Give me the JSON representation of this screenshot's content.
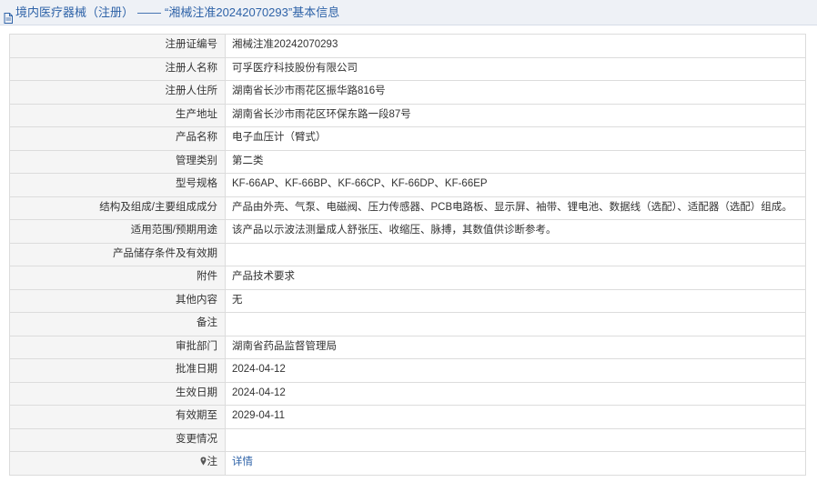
{
  "header": {
    "section": "境内医疗器械（注册）",
    "dash": "——",
    "title": "“湘械注准20242070293”基本信息"
  },
  "rows": [
    {
      "label": "注册证编号",
      "value": "湘械注准20242070293"
    },
    {
      "label": "注册人名称",
      "value": "可孚医疗科技股份有限公司"
    },
    {
      "label": "注册人住所",
      "value": "湖南省长沙市雨花区振华路816号"
    },
    {
      "label": "生产地址",
      "value": "湖南省长沙市雨花区环保东路一段87号"
    },
    {
      "label": "产品名称",
      "value": "电子血压计（臂式）"
    },
    {
      "label": "管理类别",
      "value": "第二类"
    },
    {
      "label": "型号规格",
      "value": "KF-66AP、KF-66BP、KF-66CP、KF-66DP、KF-66EP"
    },
    {
      "label": "结构及组成/主要组成成分",
      "value": "产品由外壳、气泵、电磁阀、压力传感器、PCB电路板、显示屏、袖带、锂电池、数据线（选配）、适配器（选配）组成。"
    },
    {
      "label": "适用范围/预期用途",
      "value": "该产品以示波法测量成人舒张压、收缩压、脉搏，其数值供诊断参考。"
    },
    {
      "label": "产品储存条件及有效期",
      "value": ""
    },
    {
      "label": "附件",
      "value": "产品技术要求"
    },
    {
      "label": "其他内容",
      "value": "无"
    },
    {
      "label": "备注",
      "value": ""
    },
    {
      "label": "审批部门",
      "value": "湖南省药品监督管理局"
    },
    {
      "label": "批准日期",
      "value": "2024-04-12"
    },
    {
      "label": "生效日期",
      "value": "2024-04-12"
    },
    {
      "label": "有效期至",
      "value": "2029-04-11"
    },
    {
      "label": "变更情况",
      "value": ""
    }
  ],
  "note": {
    "pin_icon": "map-pin-icon",
    "label": "注",
    "link": "详情"
  },
  "colors": {
    "header_bg": "#eef1f6",
    "link": "#2f63a8",
    "label_bg": "#f5f5f5",
    "border": "#dcdcdc"
  }
}
